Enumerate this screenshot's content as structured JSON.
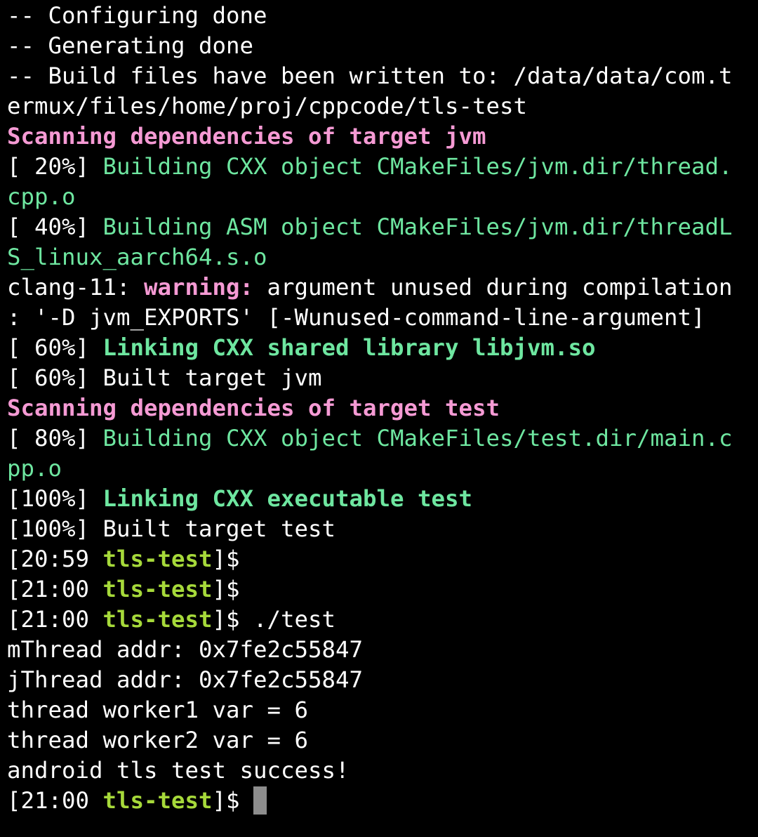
{
  "terminal": {
    "colors": {
      "background": "#000000",
      "text": "#ffffff",
      "scanning": "#f59ad4",
      "building": "#6ee6a0",
      "prompt_dir": "#a6d93a",
      "cursor": "#8d8d8d"
    },
    "lines": [
      [
        {
          "t": "-- Configuring done",
          "c": "white"
        }
      ],
      [
        {
          "t": "-- Generating done",
          "c": "white"
        }
      ],
      [
        {
          "t": "-- Build files have been written to: /data/data/com.t",
          "c": "white"
        }
      ],
      [
        {
          "t": "ermux/files/home/proj/cppcode/tls-test",
          "c": "white"
        }
      ],
      [
        {
          "t": "Scanning dependencies of target jvm",
          "c": "magenta",
          "b": true
        }
      ],
      [
        {
          "t": "[ 20%] ",
          "c": "white"
        },
        {
          "t": "Building CXX object CMakeFiles/jvm.dir/thread.",
          "c": "green"
        }
      ],
      [
        {
          "t": "cpp.o",
          "c": "green"
        }
      ],
      [
        {
          "t": "[ 40%] ",
          "c": "white"
        },
        {
          "t": "Building ASM object CMakeFiles/jvm.dir/threadL",
          "c": "green"
        }
      ],
      [
        {
          "t": "S_linux_aarch64.s.o",
          "c": "green"
        }
      ],
      [
        {
          "t": "clang-11: ",
          "c": "white"
        },
        {
          "t": "warning:",
          "c": "magenta",
          "b": true
        },
        {
          "t": " argument unused during compilation",
          "c": "white"
        }
      ],
      [
        {
          "t": ": '-D jvm_EXPORTS' [-Wunused-command-line-argument]",
          "c": "white"
        }
      ],
      [
        {
          "t": "[ 60%] ",
          "c": "white"
        },
        {
          "t": "Linking CXX shared library libjvm.so",
          "c": "green",
          "b": true
        }
      ],
      [
        {
          "t": "[ 60%] Built target jvm",
          "c": "white"
        }
      ],
      [
        {
          "t": "Scanning dependencies of target test",
          "c": "magenta",
          "b": true
        }
      ],
      [
        {
          "t": "[ 80%] ",
          "c": "white"
        },
        {
          "t": "Building CXX object CMakeFiles/test.dir/main.c",
          "c": "green"
        }
      ],
      [
        {
          "t": "pp.o",
          "c": "green"
        }
      ],
      [
        {
          "t": "[100%] ",
          "c": "white"
        },
        {
          "t": "Linking CXX executable test",
          "c": "green",
          "b": true
        }
      ],
      [
        {
          "t": "[100%] Built target test",
          "c": "white"
        }
      ],
      [
        {
          "t": "[20:59 ",
          "c": "white"
        },
        {
          "t": "tls-test",
          "c": "prompt",
          "b": true
        },
        {
          "t": "]$",
          "c": "white"
        }
      ],
      [
        {
          "t": "[21:00 ",
          "c": "white"
        },
        {
          "t": "tls-test",
          "c": "prompt",
          "b": true
        },
        {
          "t": "]$",
          "c": "white"
        }
      ],
      [
        {
          "t": "[21:00 ",
          "c": "white"
        },
        {
          "t": "tls-test",
          "c": "prompt",
          "b": true
        },
        {
          "t": "]$ ./test",
          "c": "white"
        }
      ],
      [
        {
          "t": "mThread addr: 0x7fe2c55847",
          "c": "white"
        }
      ],
      [
        {
          "t": "jThread addr: 0x7fe2c55847",
          "c": "white"
        }
      ],
      [
        {
          "t": "thread worker1 var = 6",
          "c": "white"
        }
      ],
      [
        {
          "t": "thread worker2 var = 6",
          "c": "white"
        }
      ],
      [
        {
          "t": "android tls test success!",
          "c": "white"
        }
      ],
      [
        {
          "t": "[21:00 ",
          "c": "white"
        },
        {
          "t": "tls-test",
          "c": "prompt",
          "b": true
        },
        {
          "t": "]$ ",
          "c": "white"
        },
        {
          "cursor": true
        }
      ]
    ]
  }
}
